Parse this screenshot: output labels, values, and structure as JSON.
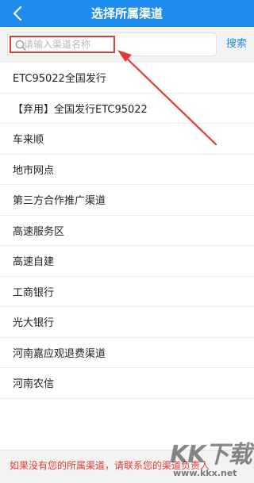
{
  "header": {
    "title": "选择所属渠道",
    "back_icon": "chevron-left-icon"
  },
  "search": {
    "placeholder": "请输入渠道名称",
    "button_label": "搜索",
    "icon": "search-icon"
  },
  "channels": [
    {
      "label": "ETC95022全国发行"
    },
    {
      "label": "【弃用】全国发行ETC95022"
    },
    {
      "label": "车来顺"
    },
    {
      "label": "地市网点"
    },
    {
      "label": "第三方合作推广渠道"
    },
    {
      "label": "高速服务区"
    },
    {
      "label": "高速自建"
    },
    {
      "label": "工商银行"
    },
    {
      "label": "光大银行"
    },
    {
      "label": "河南嘉应观退费渠道"
    },
    {
      "label": "河南农信"
    }
  ],
  "footer": {
    "note": "如果没有您的所属渠道，请联系您的渠道负责人"
  },
  "watermark": {
    "logo": "KK下载",
    "url": "www.kkx.net"
  },
  "colors": {
    "header_bg": "#1f8df0",
    "accent": "#1f8df0",
    "annotation_red": "#e53935",
    "note_red": "#e53935"
  }
}
